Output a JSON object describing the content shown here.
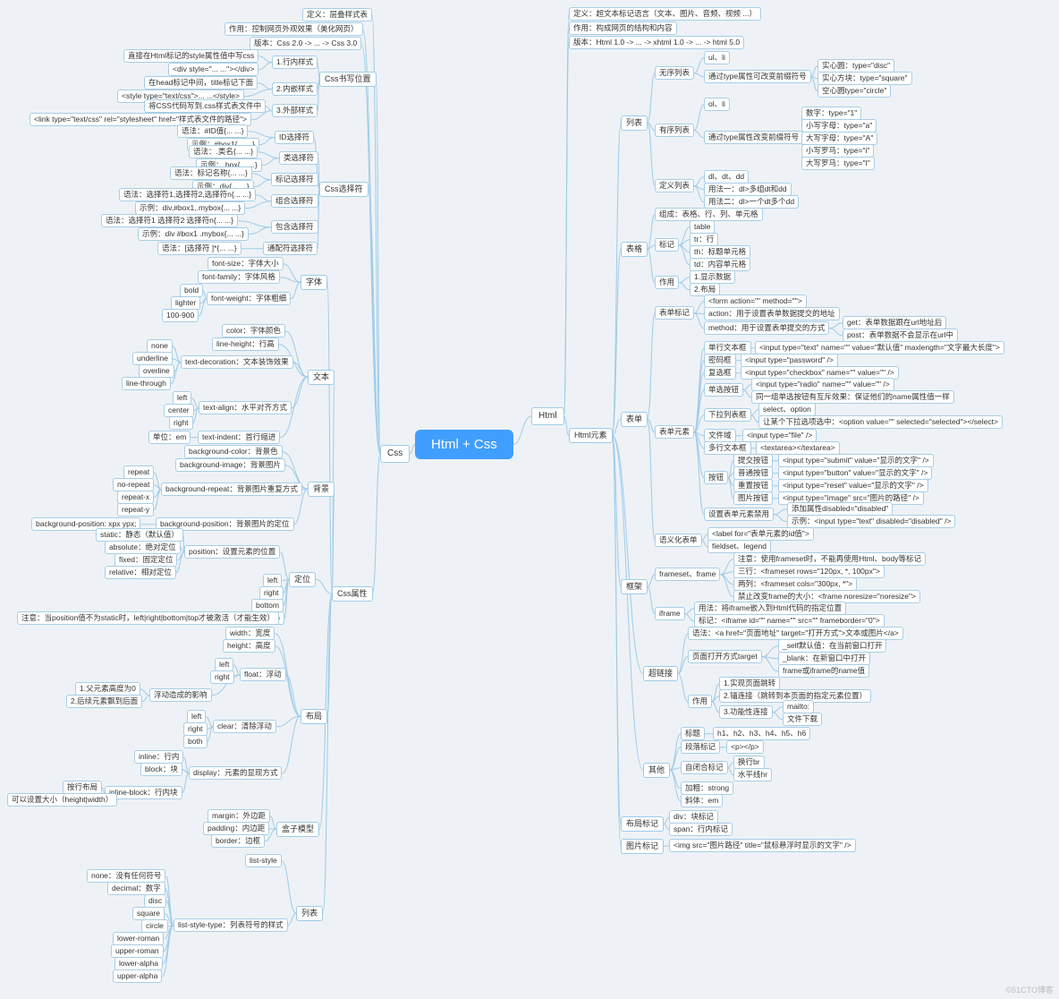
{
  "watermark": "©51CTO博客",
  "root": "Html + Css",
  "left": {
    "css": "Css",
    "a_def": "定义：层叠样式表",
    "a_use": "作用：控制网页外观效果（美化网页）",
    "a_ver": "版本：Css 2.0 -> ... -> Css 3.0",
    "pos_lbl": "Css书写位置",
    "pos1": "1.行内样式",
    "pos1a": "直接在Html标记的style属性值中写css",
    "pos1b": "<div style=\"... ...\"></div>",
    "pos2": "2.内嵌样式",
    "pos2a": "在head标记中间，title标记下面",
    "pos2b": "<style type=\"text/css\">... ...</style>",
    "pos3": "3.外部样式",
    "pos3a": "将CSS代码写到.css样式表文件中",
    "pos3b": "<link type=\"text/css\" rel=\"stylesheet\" href=\"样式表文件的路径\">",
    "sel_lbl": "Css选择符",
    "sel_id": "ID选择符",
    "sel_id1": "语法：#ID值{... ...}",
    "sel_id2": "示例：#box1{... ...}",
    "sel_cls": "类选择符",
    "sel_cls1": "语法：.类名{... ...}",
    "sel_cls2": "示例：.box{... ...}",
    "sel_tag": "标记选择符",
    "sel_tag1": "语法：标记名称{... ...}",
    "sel_tag2": "示例：div{... ...}",
    "sel_grp": "组合选择符",
    "sel_grp1": "语法：选择符1,选择符2,选择符n{... ...}",
    "sel_grp2": "示例：div,#box1,.mybox{... ...}",
    "sel_inc": "包含选择符",
    "sel_inc1": "语法：选择符1  选择符2   选择符n{... ...}",
    "sel_inc2": "示例：div #box1 .mybox{... ...}",
    "sel_all": "通配符选择符",
    "sel_all1": "语法：[选择符   ]*{... ...}",
    "prop_lbl": "Css属性",
    "font_lbl": "字体",
    "font1": "font-size：字体大小",
    "font2": "font-family：字体风格",
    "fontw": "font-weight：字体粗细",
    "fw1": "bold",
    "fw2": "lighter",
    "fw3": "100-900",
    "text_lbl": "文本",
    "t1": "color：字体颜色",
    "t2": "line-height：行高",
    "td": "text-decoration：文本装饰效果",
    "td1": "none",
    "td2": "underline",
    "td3": "overline",
    "td4": "line-through",
    "ta": "text-align：水平对齐方式",
    "ta1": "left",
    "ta2": "center",
    "ta3": "right",
    "ti": "text-indent：首行缩进",
    "ti_unit": "单位：em",
    "bg_lbl": "背景",
    "bg1": "background-color：背景色",
    "bg2": "background-image：背景图片",
    "bgr": "background-repeat：背景图片重复方式",
    "bgr1": "repeat",
    "bgr2": "no-repeat",
    "bgr3": "repeat-x",
    "bgr4": "repeat-y",
    "bgp": "background-position：背景图片的定位",
    "bgp1": "background-position: xpx ypx;",
    "pos_grp": "定位",
    "p_pos": "position：设置元素的位置",
    "pp1": "static：静态（默认值）",
    "pp2": "absolute：绝对定位",
    "pp3": "fixed：固定定位",
    "pp4": "relative：相对定位",
    "pd1": "left",
    "pd2": "right",
    "pd3": "bottom",
    "pd4": "top",
    "p_note": "注意：当position值不为static时，left|right|bottom|top才被激活（才能生效）",
    "lay_lbl": "布局",
    "lw": "width：宽度",
    "lh": "height：高度",
    "flt": "float：浮动",
    "f1": "left",
    "f2": "right",
    "fe": "浮动造成的影响",
    "fe1": "1.父元素高度为0",
    "fe2": "2.后续元素飘到后面",
    "clr": "clear：清除浮动",
    "c1": "left",
    "c2": "right",
    "c3": "both",
    "disp": "display：元素的显现方式",
    "d1": "inline：行内",
    "d2": "block：块",
    "d3": "inline-block：行内块",
    "d3a": "按行布局",
    "d3b": "可以设置大小（height|width）",
    "box_lbl": "盒子模型",
    "bm1": "margin：外边距",
    "bm2": "padding：内边距",
    "bm3": "border：边框",
    "list_lbl": "列表",
    "ls": "list-style",
    "lst": "list-style-type：列表符号的样式",
    "l1": "none：没有任何符号",
    "l2": "decimal：数字",
    "l3": "disc",
    "l4": "square",
    "l5": "circle",
    "l6": "lower-roman",
    "l7": "upper-roman",
    "l8": "lower-alpha",
    "l9": "upper-alpha"
  },
  "right": {
    "html": "Html",
    "a_def": "定义：超文本标记语言（文本、图片、音频、视频 ...）",
    "a_use": "作用：构成网页的结构和内容",
    "a_ver": "版本：Html 1.0 -> ... -> xhtml 1.0 -> ... -> html 5.0",
    "elem": "Html元素",
    "list": "列表",
    "ul_lbl": "无序列表",
    "ul1": "ul、li",
    "ul_type": "通过type属性可改变前缀符号",
    "ul_t1": "实心圆：type=\"disc\"",
    "ul_t2": "实心方块：type=\"square\"",
    "ul_t3": "空心圆type=\"circle\"",
    "ol_lbl": "有序列表",
    "ol1": "ol、li",
    "ol_type": "通过type属性改变前缀符号",
    "ol_t1": "数字：type=\"1\"",
    "ol_t2": "小写字母：type=\"a\"",
    "ol_t3": "大写字母：type=\"A\"",
    "ol_t4": "小写罗马：type=\"i\"",
    "ol_t5": "大写罗马：type=\"I\"",
    "dl_lbl": "定义列表",
    "dl1": "dl、dt、dd",
    "dl2": "用法一：dl>多组dt和dd",
    "dl3": "用法二：dl>一个dt多个dd",
    "tbl": "表格",
    "tbl_make": "组成：表格、行、列、单元格",
    "tbl_tag": "标记",
    "tt1": "table",
    "tt2": "tr：行",
    "tt3": "th：标题单元格",
    "tt4": "td：内容单元格",
    "tbl_use": "作用",
    "tu1": "1.显示数据",
    "tu2": "2.布局",
    "form": "表单",
    "form_tag": "表单标记",
    "ft1": "<form action=\"\" method=\"\">",
    "ft2": "action：用于设置表单数据提交的地址",
    "ft3": "method：用于设置表单提交的方式",
    "ft3a": "get：表单数据跟在url地址后",
    "ft3b": "post：表单数据不会显示在url中",
    "form_el": "表单元素",
    "fe_text": "单行文本框",
    "fe_text1": "<input type=\"text\" name=\"\" value=\"默认值\" maxlength=\"文字最大长度\">",
    "fe_pwd": "密码框",
    "fe_pwd1": "<input type=\"password\" />",
    "fe_chk": "复选框",
    "fe_chk1": "<input type=\"checkbox\" name=\"\" value=\"\" />",
    "fe_rad": "单选按钮",
    "fe_rad1": "<input type=\"radio\" name=\"\" value=\"\" />",
    "fe_rad2": "同一组单选按钮有互斥效果：保证他们的name属性值一样",
    "fe_sel": "下拉列表框",
    "fe_sel1": "select、option",
    "fe_sel2": "让某个下拉选项选中：<option value=\"\" selected=\"selected\"></select>",
    "fe_file": "文件域",
    "fe_file1": "<input type=\"file\" />",
    "fe_ta": "多行文本框",
    "fe_ta1": "<textarea></textarea>",
    "fe_btn": "按钮",
    "fb1": "提交按钮",
    "fb1a": "<input type=\"submit\" value=\"显示的文字\" />",
    "fb2": "普通按钮",
    "fb2a": "<input type=\"button\" value=\"显示的文字\" />",
    "fb3": "重置按钮",
    "fb3a": "<input type=\"reset\" value=\"显示的文字\" />",
    "fb4": "图片按钮",
    "fb4a": "<input type=\"image\" src=\"图片的路径\" />",
    "fe_dis": "设置表单元素禁用",
    "fd1": "添加属性disabled=\"disabled\"",
    "fd2": "示例：<input type=\"text\" disabled=\"disabled\" />",
    "sem": "语义化表单",
    "sem1": "<label for=\"表单元素的id值\">",
    "sem2": "fieldset、legend",
    "frame": "框架",
    "fs": "frameset、frame",
    "fsn": "注意：使用frameset时，不能再使用Html、body等标记",
    "fs1": "三行：<frameset rows=\"120px, *, 100px\">",
    "fs2": "两列：<frameset cols=\"300px, *\">",
    "fs3": "禁止改变frame的大小：<frame noresize=\"noresize\">",
    "ifr": "iframe",
    "ifr1": "用法：将iframe嵌入到Html代码的指定位置",
    "ifr2": "标记：<iframe id=\"\" name=\"\" src=\"\" frameborder=\"0\">",
    "link": "超链接",
    "lk_syn": "语法：<a href=\"页面地址\" target=\"打开方式\">文本或图片</a>",
    "lk_tgt": "页面打开方式target",
    "lt1": "_self默认值：在当前窗口打开",
    "lt2": "_blank：在新窗口中打开",
    "lt3": "frame或iframe的name值",
    "lk_use": "作用",
    "lu1": "1.实现页面跳转",
    "lu2": "2.锚连接（跳转到本页面的指定元素位置）",
    "lu3": "3.功能性连接",
    "lu3a": "mailto:",
    "lu3b": "文件下载",
    "other": "其他",
    "o_h": "标题",
    "o_h1": "h1、h2、h3、h4、h5、h6",
    "o_p": "段落标记",
    "o_p1": "<p></p>",
    "o_self": "自闭合标记",
    "os1": "换行br",
    "os2": "水平线hr",
    "o_b": "加粗：strong",
    "o_i": "斜体：em",
    "layout": "布局标记",
    "lay1": "div：块标记",
    "lay2": "span：行内标记",
    "img": "图片标记",
    "img1": "<img src=\"图片路径\" title=\"鼠标悬浮时显示的文字\" />"
  }
}
